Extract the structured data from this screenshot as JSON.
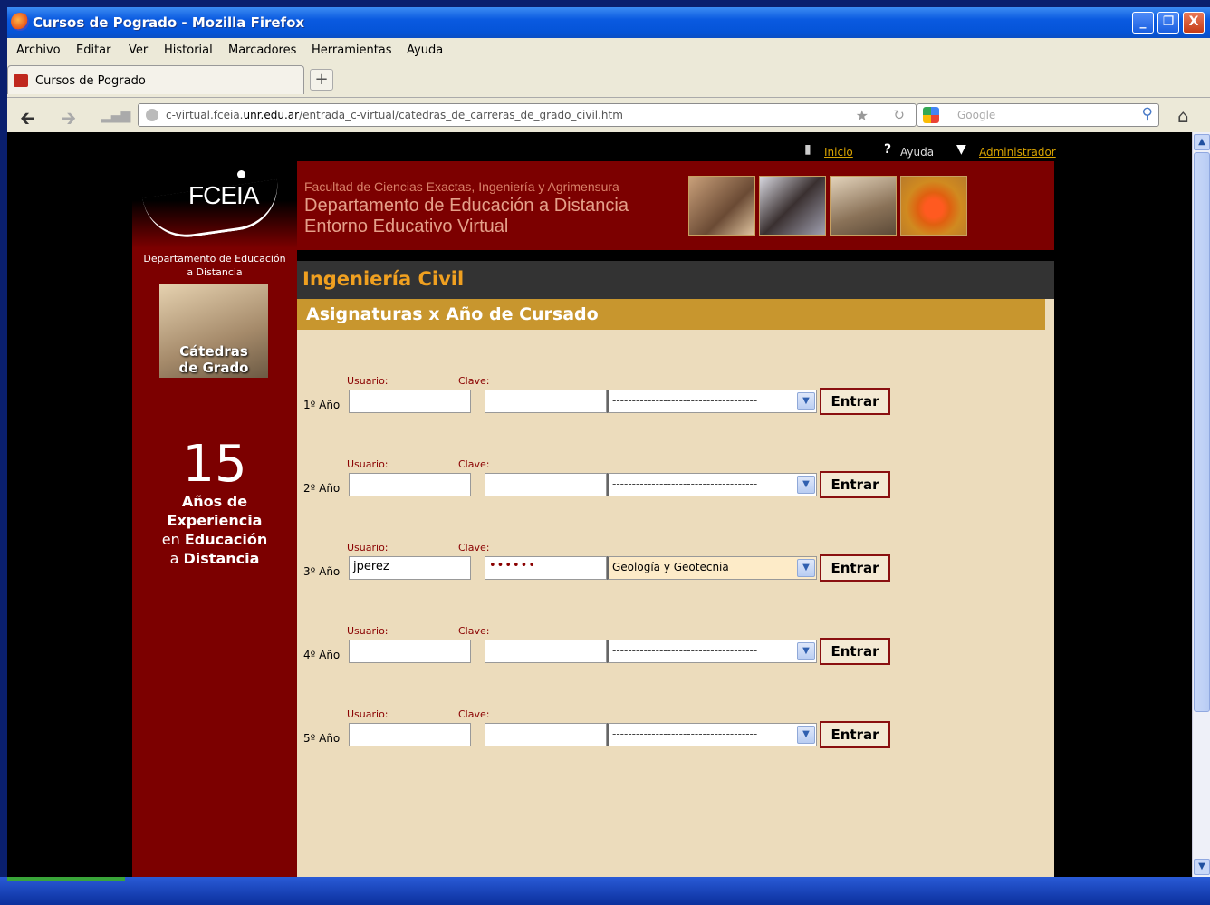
{
  "window": {
    "title": "Cursos de Pogrado - Mozilla Firefox",
    "buttons": {
      "minimize": "_",
      "maximize": "❐",
      "close": "X"
    }
  },
  "menu": [
    "Archivo",
    "Editar",
    "Ver",
    "Historial",
    "Marcadores",
    "Herramientas",
    "Ayuda"
  ],
  "tab": {
    "label": "Cursos de Pogrado",
    "new_tab": "+"
  },
  "nav": {
    "url_host_pre": "c-virtual.fceia.",
    "url_host_bold": "unr.edu.ar",
    "url_path": "/entrada_c-virtual/catedras_de_carreras_de_grado_civil.htm",
    "search_placeholder": "Google"
  },
  "page": {
    "top_links": {
      "inicio": "Inicio",
      "ayuda": "Ayuda",
      "admin": "Administrador"
    },
    "logo_text": "FCEIA",
    "dept_label_1": "Departamento de Educación",
    "dept_label_2": "a Distancia",
    "catedras_1": "Cátedras",
    "catedras_2": "de Grado",
    "years_num": "15",
    "years_line1": "Años de",
    "years_line2": "Experiencia",
    "years_line3_a": "en ",
    "years_line3_b": "Educación",
    "years_line4_a": "a ",
    "years_line4_b": "Distancia",
    "header_l1": "Facultad de Ciencias Exactas, Ingeniería y Agrimensura",
    "header_l2": "Departamento de Educación a Distancia",
    "header_l3": "Entorno Educativo Virtual",
    "title": "Ingeniería Civil",
    "subtitle": "Asignaturas x Año de Cursado",
    "usuario_label": "Usuario:",
    "clave_label": "Clave:",
    "enter_label": "Entrar",
    "rows": [
      {
        "year": "1º Año",
        "user": "",
        "pass": "",
        "select": "-------------------------------------"
      },
      {
        "year": "2º Año",
        "user": "",
        "pass": "",
        "select": "-------------------------------------"
      },
      {
        "year": "3º Año",
        "user": "jperez",
        "pass": "••••••",
        "select": "Geología y Geotecnia"
      },
      {
        "year": "4º Año",
        "user": "",
        "pass": "",
        "select": "-------------------------------------"
      },
      {
        "year": "5º Año",
        "user": "",
        "pass": "",
        "select": "-------------------------------------"
      }
    ]
  },
  "colors": {
    "sidebar": "#7c0000",
    "accent": "#f0a020",
    "subtitle_bar": "#c8962e",
    "content_bg": "#ecdcbc"
  }
}
